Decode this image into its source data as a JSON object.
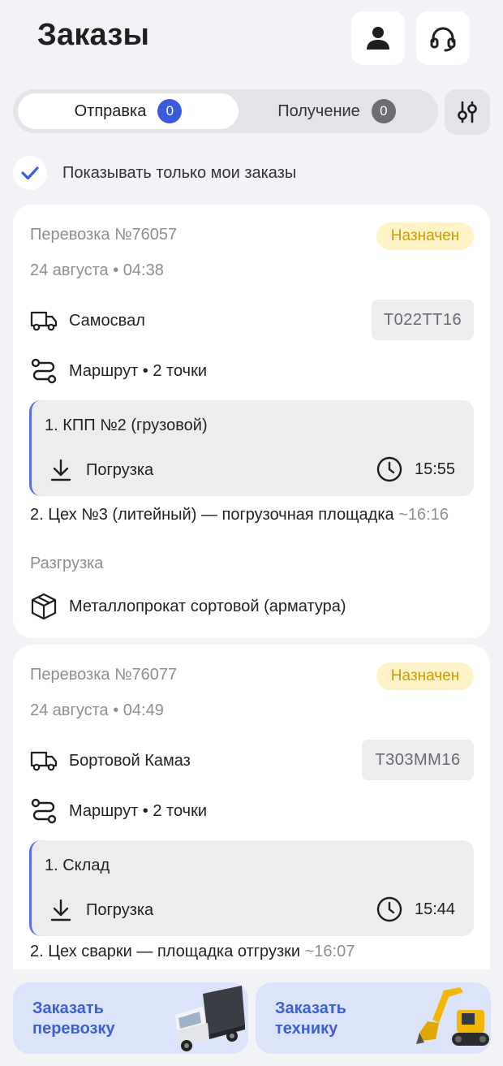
{
  "header": {
    "title": "Заказы",
    "profile_icon": "person-icon",
    "support_icon": "headset-icon"
  },
  "tabs": [
    {
      "label": "Отправка",
      "count": "0",
      "active": true
    },
    {
      "label": "Получение",
      "count": "0",
      "active": false
    }
  ],
  "filter_icon": "sliders-icon",
  "only_mine": {
    "label": "Показывать только мои заказы",
    "checked": true
  },
  "colors": {
    "accent": "#3b5bdb",
    "status_bg": "#fdf3c6",
    "status_text": "#d29a00",
    "background": "#f2f3f7"
  },
  "orders": [
    {
      "id": "Перевозка №76057",
      "status": "Назначен",
      "date": "24 августа • 04:38",
      "vehicle": "Самосвал",
      "plate": "Т022ТТ16",
      "route": "Маршрут • 2 точки",
      "point1": {
        "name": "1. КПП №2 (грузовой)",
        "operation": "Погрузка",
        "time": "15:55"
      },
      "point2": {
        "name": "2. Цех №3 (литейный) — погрузочная площадка",
        "eta": "~16:16",
        "operation": "Разгрузка"
      },
      "cargo": "Металлопрокат сортовой (арматура)"
    },
    {
      "id": "Перевозка №76077",
      "status": "Назначен",
      "date": "24 августа • 04:49",
      "vehicle": "Бортовой Камаз",
      "plate": "Т303ММ16",
      "route": "Маршрут • 2 точки",
      "point1": {
        "name": "1. Склад",
        "operation": "Погрузка",
        "time": "15:44"
      },
      "point2": {
        "name": "2. Цех сварки — площадка отгрузки",
        "eta": "~16:07"
      }
    }
  ],
  "bottom": {
    "order_transport": "Заказать перевозку",
    "order_machinery": "Заказать технику"
  }
}
